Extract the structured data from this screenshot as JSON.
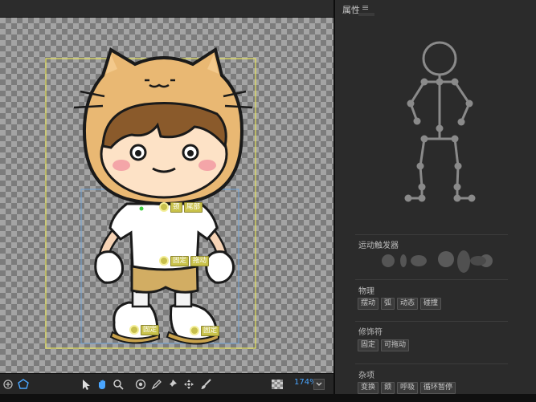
{
  "panel": {
    "title": "属性",
    "menu_icon": "hamburger-icon",
    "sections": {
      "triggers": {
        "title": "运动触发器"
      },
      "physics": {
        "title": "物理",
        "chips": [
          "摆动",
          "弧",
          "动态",
          "碰撞"
        ]
      },
      "modifiers": {
        "title": "修饰符",
        "chips": [
          "固定",
          "可拖动"
        ]
      },
      "misc": {
        "title": "杂项",
        "chips": [
          "变换",
          "颌",
          "呼吸",
          "循环暂停"
        ]
      }
    }
  },
  "stage": {
    "tags": {
      "neck": "颈",
      "tail": "尾部",
      "waist_fixed": "固定",
      "waist_drag": "拖动",
      "left_foot": "固定",
      "right_foot": "固定"
    }
  },
  "toolbar": {
    "zoom": "174%",
    "icons": [
      "puppet-icon",
      "shape-icon",
      "select-arrow-icon",
      "hand-icon",
      "zoom-icon",
      "target-icon",
      "pen-icon",
      "pin-icon",
      "move-icon",
      "brush-icon",
      "checker-icon",
      "dropdown-icon"
    ]
  },
  "colors": {
    "accent": "#4aa6ff",
    "tag": "#c9c24a",
    "bounding_box": "#e6e35c",
    "mesh_box": "#6fa3d8"
  }
}
